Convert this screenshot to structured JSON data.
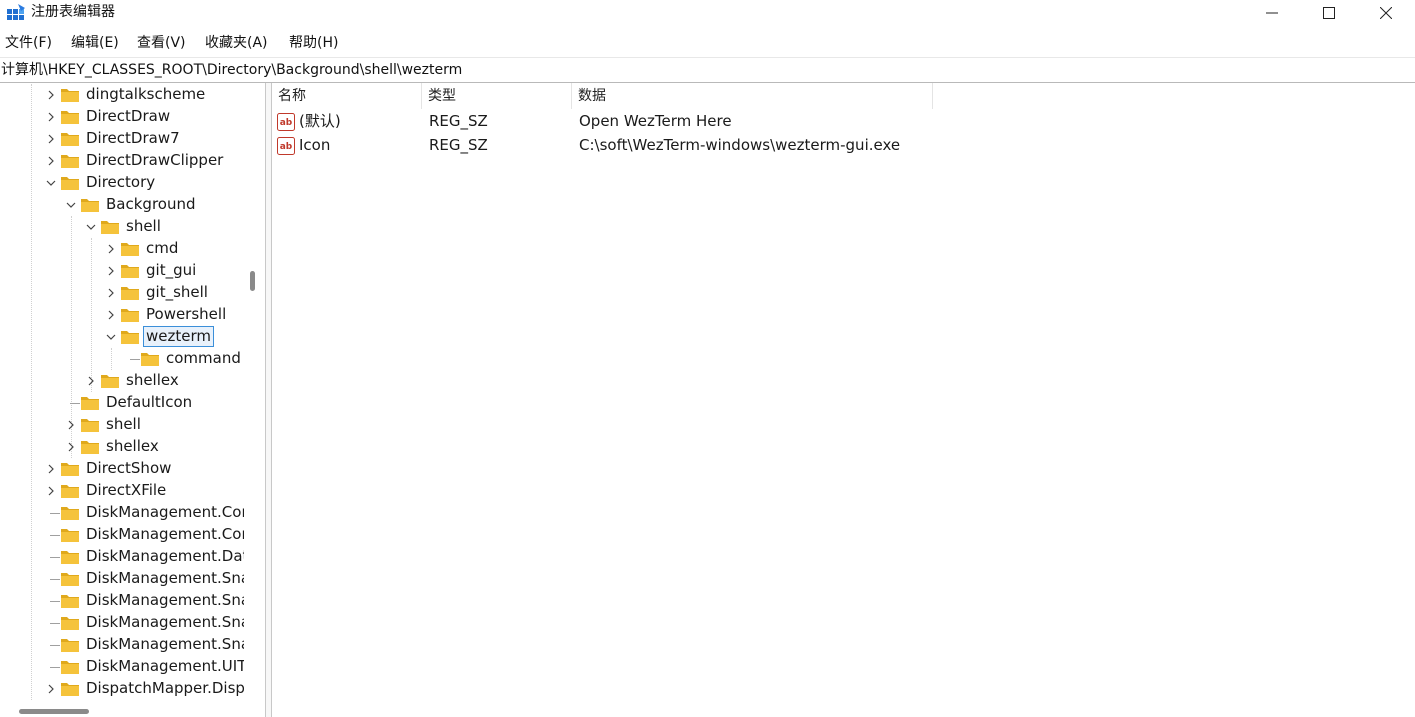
{
  "window": {
    "title": "注册表编辑器",
    "min_icon": "minimize-icon",
    "max_icon": "maximize-icon",
    "close_icon": "close-icon"
  },
  "menu": [
    "文件(F)",
    "编辑(E)",
    "查看(V)",
    "收藏夹(A)",
    "帮助(H)"
  ],
  "address": "计算机\\HKEY_CLASSES_ROOT\\Directory\\Background\\shell\\wezterm",
  "tree": [
    {
      "label": "dingtalkscheme",
      "depth": 0,
      "expander": "collapsed"
    },
    {
      "label": "DirectDraw",
      "depth": 0,
      "expander": "collapsed"
    },
    {
      "label": "DirectDraw7",
      "depth": 0,
      "expander": "collapsed"
    },
    {
      "label": "DirectDrawClipper",
      "depth": 0,
      "expander": "collapsed"
    },
    {
      "label": "Directory",
      "depth": 0,
      "expander": "expanded"
    },
    {
      "label": "Background",
      "depth": 1,
      "expander": "expanded"
    },
    {
      "label": "shell",
      "depth": 2,
      "expander": "expanded"
    },
    {
      "label": "cmd",
      "depth": 3,
      "expander": "collapsed"
    },
    {
      "label": "git_gui",
      "depth": 3,
      "expander": "collapsed"
    },
    {
      "label": "git_shell",
      "depth": 3,
      "expander": "collapsed"
    },
    {
      "label": "Powershell",
      "depth": 3,
      "expander": "collapsed"
    },
    {
      "label": "wezterm",
      "depth": 3,
      "expander": "expanded",
      "selected": true
    },
    {
      "label": "command",
      "depth": 4,
      "expander": "none"
    },
    {
      "label": "shellex",
      "depth": 2,
      "expander": "collapsed"
    },
    {
      "label": "DefaultIcon",
      "depth": 1,
      "expander": "none"
    },
    {
      "label": "shell",
      "depth": 1,
      "expander": "collapsed"
    },
    {
      "label": "shellex",
      "depth": 1,
      "expander": "collapsed"
    },
    {
      "label": "DirectShow",
      "depth": 0,
      "expander": "collapsed"
    },
    {
      "label": "DirectXFile",
      "depth": 0,
      "expander": "collapsed"
    },
    {
      "label": "DiskManagement.Cor",
      "depth": 0,
      "expander": "none"
    },
    {
      "label": "DiskManagement.Cor",
      "depth": 0,
      "expander": "none"
    },
    {
      "label": "DiskManagement.Dat",
      "depth": 0,
      "expander": "none"
    },
    {
      "label": "DiskManagement.Sna",
      "depth": 0,
      "expander": "none"
    },
    {
      "label": "DiskManagement.Sna",
      "depth": 0,
      "expander": "none"
    },
    {
      "label": "DiskManagement.Sna",
      "depth": 0,
      "expander": "none"
    },
    {
      "label": "DiskManagement.Sna",
      "depth": 0,
      "expander": "none"
    },
    {
      "label": "DiskManagement.UIT",
      "depth": 0,
      "expander": "none"
    },
    {
      "label": "DispatchMapper.Disp",
      "depth": 0,
      "expander": "collapsed"
    }
  ],
  "columns": {
    "name": "名称",
    "type": "类型",
    "data": "数据"
  },
  "values": [
    {
      "name": "(默认)",
      "type": "REG_SZ",
      "data": "Open WezTerm Here",
      "icon": "string-value-icon"
    },
    {
      "name": "Icon",
      "type": "REG_SZ",
      "data": "C:\\soft\\WezTerm-windows\\wezterm-gui.exe",
      "icon": "string-value-icon"
    }
  ],
  "colors": {
    "folder": "#f5c33b",
    "folder_dark": "#e0a91c",
    "selection_border": "#3b8fd9",
    "selection_bg": "#e8f1fb"
  }
}
